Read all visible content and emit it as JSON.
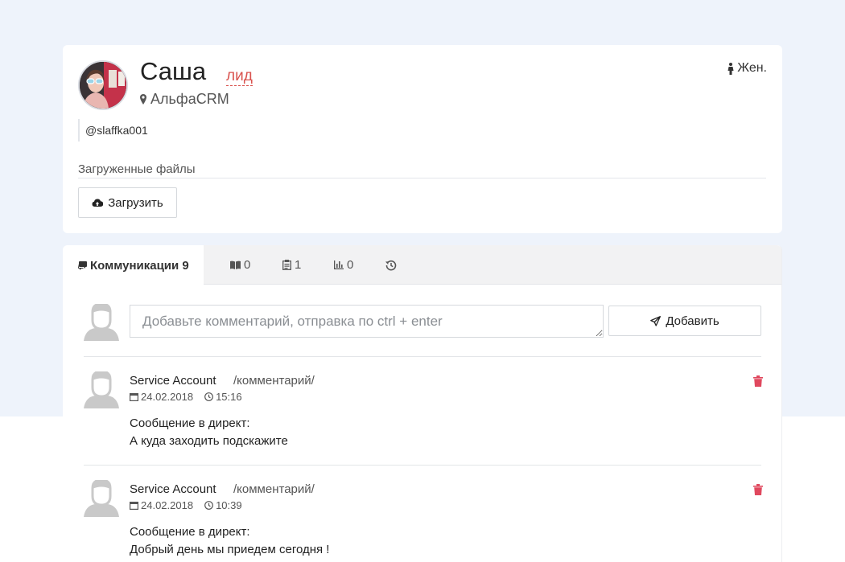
{
  "contact": {
    "name": "Саша",
    "status": "лид",
    "company": "АльфаCRM",
    "gender": "Жен.",
    "handle": "@slaffka001",
    "files_label": "Загруженные файлы",
    "upload_label": "Загрузить"
  },
  "tabs": [
    {
      "label": "Коммуникации 9",
      "icon": "comments-icon"
    },
    {
      "label": "0",
      "icon": "book-icon"
    },
    {
      "label": "1",
      "icon": "clipboard-icon"
    },
    {
      "label": "0",
      "icon": "bar-chart-icon"
    },
    {
      "label": "",
      "icon": "history-icon"
    }
  ],
  "composer": {
    "placeholder": "Добавьте комментарий, отправка по ctrl + enter",
    "add_label": "Добавить"
  },
  "entries": [
    {
      "author": "Service Account",
      "type": "/комментарий/",
      "date": "24.02.2018",
      "time": "15:16",
      "title": "Сообщение в директ:",
      "text": "А куда заходить подскажите"
    },
    {
      "author": "Service Account",
      "type": "/комментарий/",
      "date": "24.02.2018",
      "time": "10:39",
      "title": "Сообщение в директ:",
      "text": "Добрый день мы приедем сегодня !"
    }
  ],
  "colors": {
    "page_bg": "#eef3fb",
    "accent_red": "#d9534f",
    "tab_bar": "#f2f2f3"
  }
}
